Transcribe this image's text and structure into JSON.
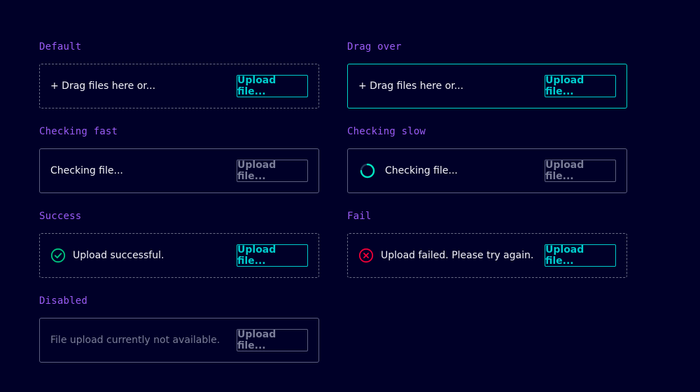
{
  "states": {
    "default": {
      "label": "Default",
      "text": "+ Drag files here or...",
      "button": "Upload file..."
    },
    "drag_over": {
      "label": "Drag over",
      "text": "+ Drag files here or...",
      "button": "Upload file..."
    },
    "checking_fast": {
      "label": "Checking fast",
      "text": "Checking file...",
      "button": "Upload file..."
    },
    "checking_slow": {
      "label": "Checking slow",
      "text": "Checking file...",
      "button": "Upload file...",
      "icon": "spinner-icon"
    },
    "success": {
      "label": "Success",
      "text": "Upload successful.",
      "button": "Upload file...",
      "icon": "check-circle-icon"
    },
    "fail": {
      "label": "Fail",
      "text": "Upload failed. Please try again.",
      "button": "Upload file...",
      "icon": "error-circle-icon"
    },
    "disabled": {
      "label": "Disabled",
      "text": "File upload currently not available.",
      "button": "Upload file..."
    }
  },
  "colors": {
    "background": "#000028",
    "label": "#9b5df5",
    "accent": "#00cccc",
    "drag_border": "#00d7c8",
    "success": "#00c781",
    "error": "#ef0137",
    "muted": "#7b7e98"
  }
}
